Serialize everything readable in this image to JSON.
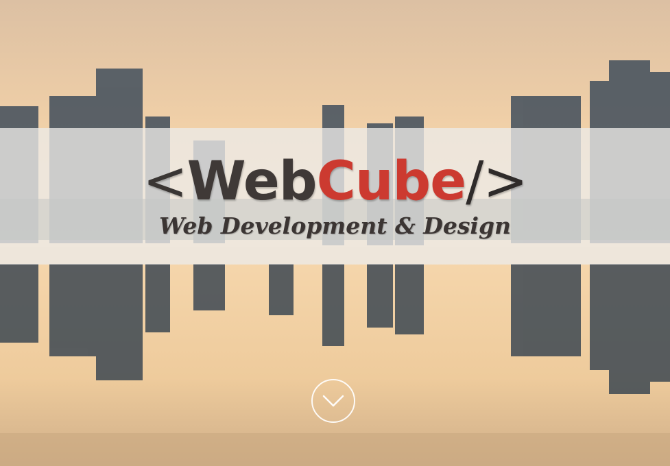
{
  "hero": {
    "logo": {
      "open_bracket": "<",
      "word_web": "Web",
      "word_cube": "Cube",
      "close_tag": "/>"
    },
    "tagline": "Web Development & Design",
    "scroll_icon": "chevron-down-circle-icon"
  },
  "colors": {
    "banner": "#ecebe8",
    "logo_dark": "#3f3937",
    "logo_accent": "#cc3a30",
    "sky_top": "#e5c6a3",
    "horizon": "#f7d9b2"
  }
}
